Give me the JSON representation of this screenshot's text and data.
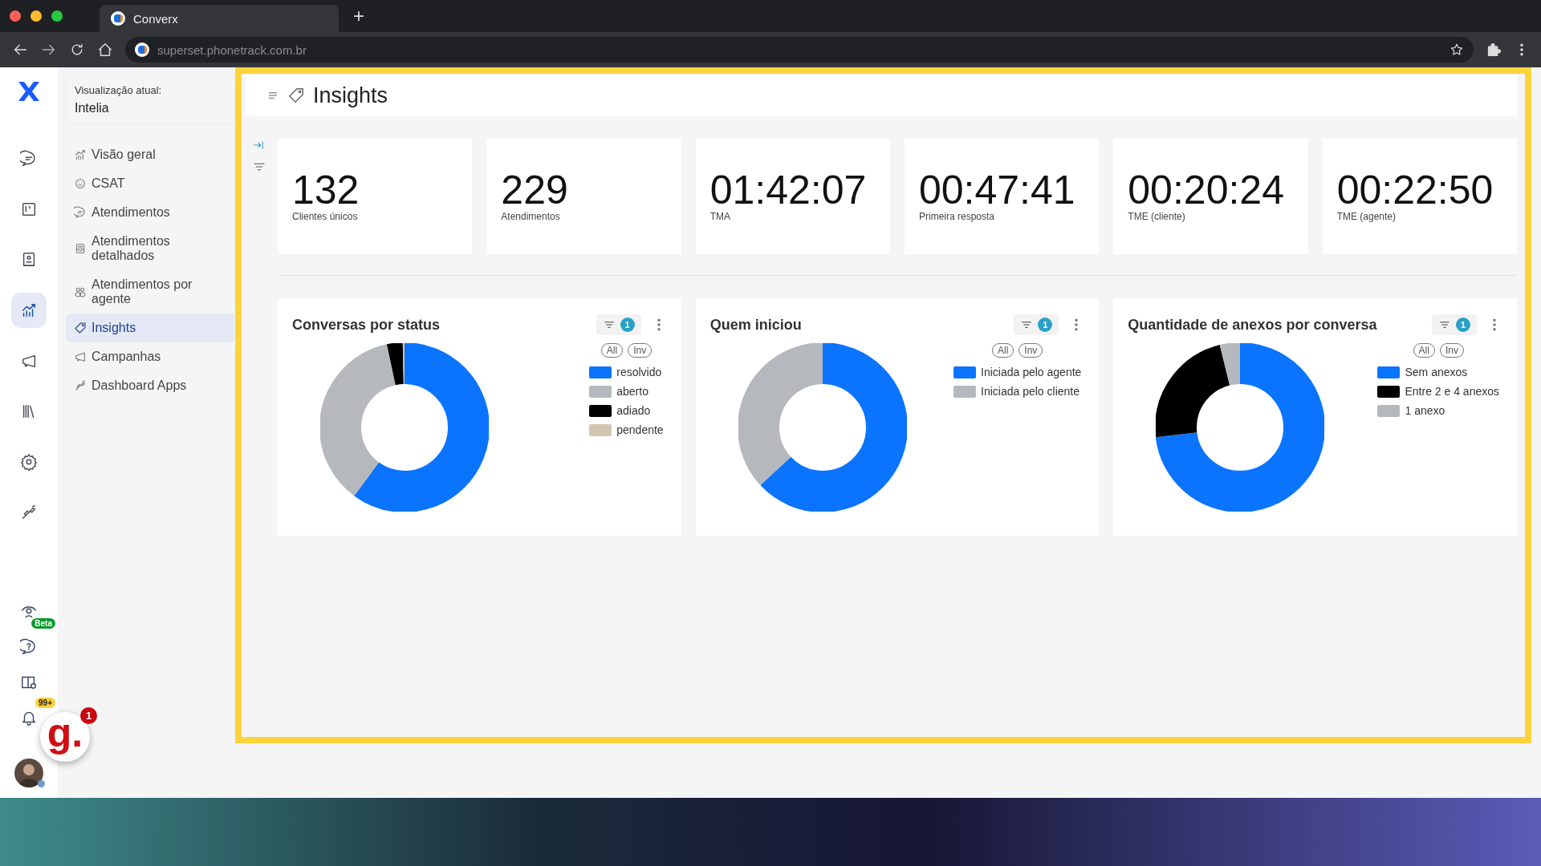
{
  "browser": {
    "tab_title": "Converx",
    "new_tab": "+",
    "url": "superset.phonetrack.com.br"
  },
  "rail": {
    "top": [
      {
        "selected": false
      },
      {
        "selected": false
      },
      {
        "selected": false
      },
      {
        "selected": true
      },
      {
        "selected": false
      },
      {
        "selected": false
      },
      {
        "selected": false
      },
      {
        "selected": false
      }
    ],
    "beta_badge": "Beta",
    "bell_badge": "99+"
  },
  "sidebar": {
    "view_label": "Visualização atual:",
    "view_value": "Intelia",
    "items": [
      {
        "label": "Visão geral",
        "selected": false
      },
      {
        "label": "CSAT",
        "selected": false
      },
      {
        "label": "Atendimentos",
        "selected": false
      },
      {
        "label": "Atendimentos detalhados",
        "selected": false
      },
      {
        "label": "Atendimentos por agente",
        "selected": false
      },
      {
        "label": "Insights",
        "selected": true
      },
      {
        "label": "Campanhas",
        "selected": false
      },
      {
        "label": "Dashboard Apps",
        "selected": false
      }
    ]
  },
  "header": {
    "title": "Insights"
  },
  "kpis": [
    {
      "value": "132",
      "label": "Clientes únicos"
    },
    {
      "value": "229",
      "label": "Atendimentos"
    },
    {
      "value": "01:42:07",
      "label": "TMA"
    },
    {
      "value": "00:47:41",
      "label": "Primeira resposta"
    },
    {
      "value": "00:20:24",
      "label": "TME (cliente)"
    },
    {
      "value": "00:22:50",
      "label": "TME (agente)"
    }
  ],
  "charts": [
    {
      "title": "Conversas por status",
      "filter_count": "1",
      "all": "All",
      "inv": "Inv",
      "legend": [
        {
          "label": "resolvido",
          "color": "#0a74ff"
        },
        {
          "label": "aberto",
          "color": "#b5b8bd"
        },
        {
          "label": "adiado",
          "color": "#000000"
        },
        {
          "label": "pendente",
          "color": "#d3c6ae"
        }
      ]
    },
    {
      "title": "Quem iniciou",
      "filter_count": "1",
      "all": "All",
      "inv": "Inv",
      "legend": [
        {
          "label": "Iniciada pelo agente",
          "color": "#0a74ff"
        },
        {
          "label": "Iniciada pelo cliente",
          "color": "#b5b8bd"
        }
      ]
    },
    {
      "title": "Quantidade de anexos por conversa",
      "filter_count": "1",
      "all": "All",
      "inv": "Inv",
      "legend": [
        {
          "label": "Sem anexos",
          "color": "#0a74ff"
        },
        {
          "label": "Entre 2 e 4 anexos",
          "color": "#000000"
        },
        {
          "label": "1 anexo",
          "color": "#b5b8bd"
        }
      ]
    }
  ],
  "widget": {
    "logo": "g.",
    "badge": "1"
  }
}
